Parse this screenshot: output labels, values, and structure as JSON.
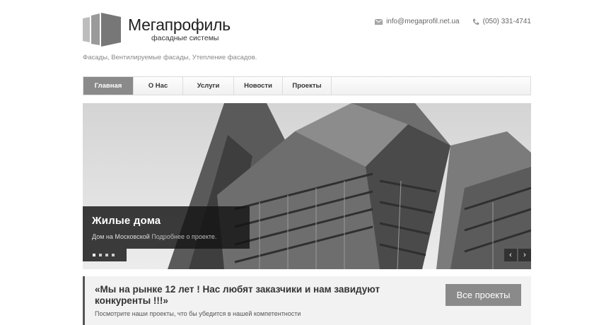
{
  "header": {
    "logo_name": "Мегапрофиль",
    "logo_sub": "фасадные системы",
    "email": "info@megaprofil.net.ua",
    "phone": "(050) 331-4741",
    "tagline": "Фасады, Вентилируемые фасады, Утепление фасадов."
  },
  "nav": {
    "items": [
      "Главная",
      "О Нас",
      "Услуги",
      "Новости",
      "Проекты"
    ],
    "active": 0
  },
  "slider": {
    "caption_title": "Жилые дома",
    "caption_text": "Дом на Московской",
    "caption_more": "Подробнее о проекте.",
    "dots": 4,
    "active_dot": 0,
    "prev_label": "‹",
    "next_label": "›"
  },
  "promo": {
    "title": "«Мы на рынке 12 лет ! Нас любят заказчики и нам завидуют конкуренты !!!»",
    "subtitle": "Посмотрите наши проекты, что бы убедится в нашей компетентности",
    "button": "Все проекты"
  },
  "icons": {
    "email": "envelope-icon",
    "phone": "phone-icon"
  }
}
